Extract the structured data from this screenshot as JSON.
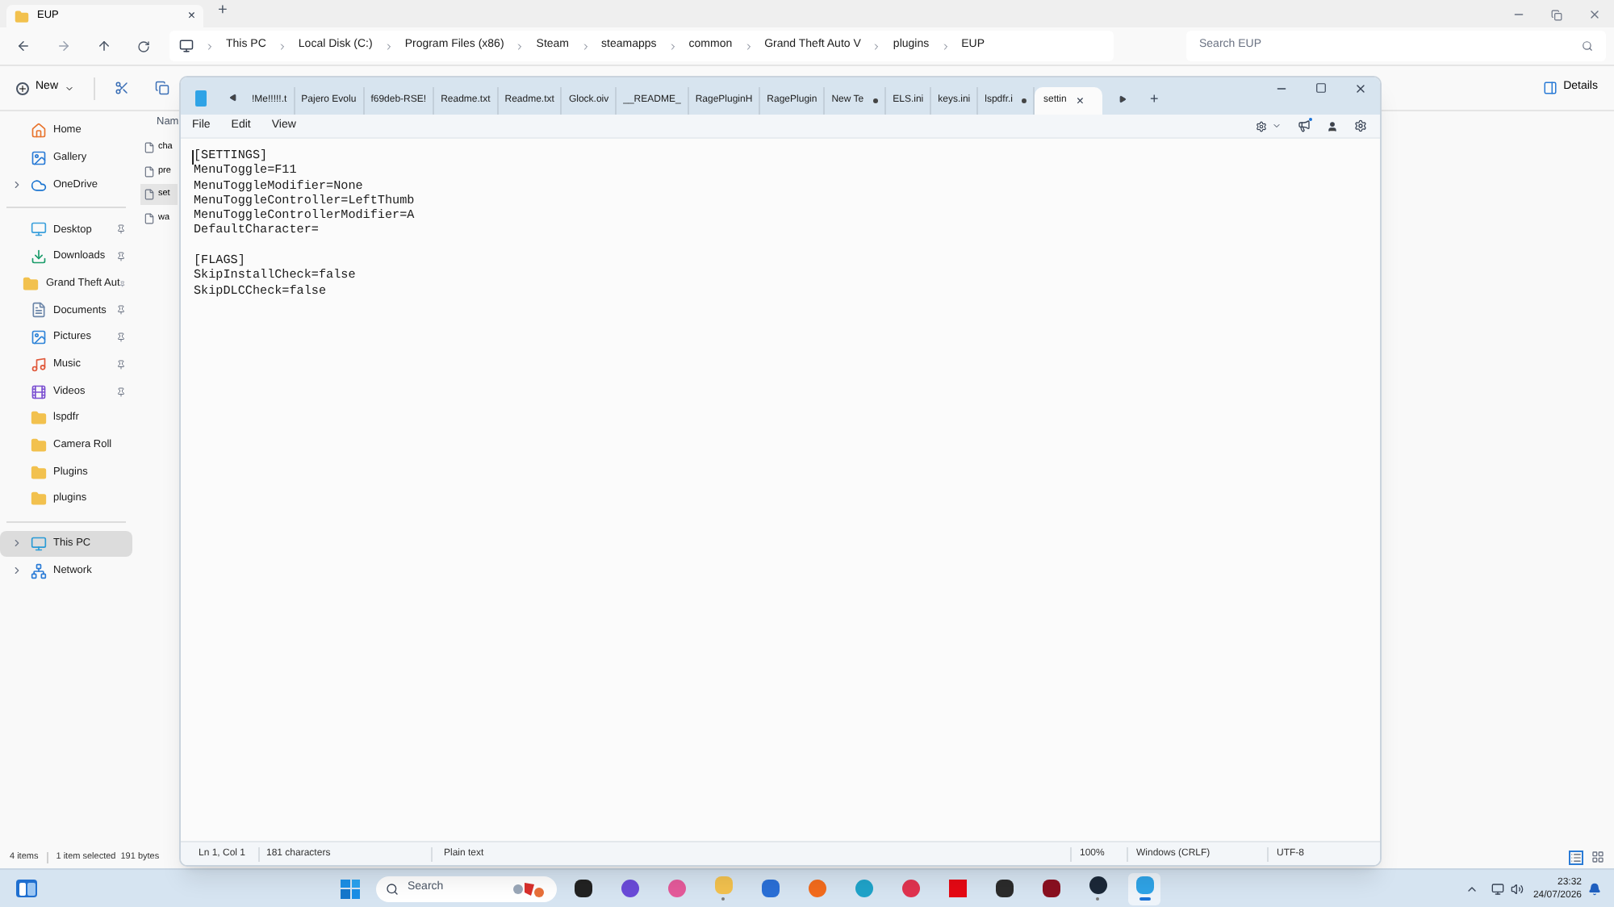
{
  "explorer": {
    "tab": {
      "title": "EUP",
      "close": "×"
    },
    "new_tab": "+",
    "breadcrumb": [
      "This PC",
      "Local Disk (C:)",
      "Program Files (x86)",
      "Steam",
      "steamapps",
      "common",
      "Grand Theft Auto V",
      "plugins",
      "EUP"
    ],
    "search": {
      "placeholder": "Search EUP"
    },
    "toolbar": {
      "new": "New",
      "details": "Details"
    },
    "nav": [
      {
        "label": "Home",
        "selected": false,
        "pinned": false
      },
      {
        "label": "Gallery",
        "selected": false,
        "pinned": false
      },
      {
        "label": "OneDrive",
        "selected": false,
        "pinned": false,
        "expanded": false
      },
      {
        "label": "Desktop",
        "selected": false,
        "pinned": true
      },
      {
        "label": "Downloads",
        "selected": false,
        "pinned": true
      },
      {
        "label": "Grand Theft Aut",
        "selected": false,
        "pinned": true
      },
      {
        "label": "Documents",
        "selected": false,
        "pinned": true
      },
      {
        "label": "Pictures",
        "selected": false,
        "pinned": true
      },
      {
        "label": "Music",
        "selected": false,
        "pinned": true
      },
      {
        "label": "Videos",
        "selected": false,
        "pinned": true
      },
      {
        "label": "lspdfr",
        "selected": false,
        "pinned": false
      },
      {
        "label": "Camera Roll",
        "selected": false,
        "pinned": false
      },
      {
        "label": "Plugins",
        "selected": false,
        "pinned": false
      },
      {
        "label": "plugins",
        "selected": false,
        "pinned": false
      },
      {
        "label": "This PC",
        "selected": true,
        "pinned": false,
        "expanded": false
      },
      {
        "label": "Network",
        "selected": false,
        "pinned": false,
        "expanded": false
      }
    ],
    "file_list": {
      "column_1": "Nam",
      "files": [
        {
          "name": "cha",
          "selected": false
        },
        {
          "name": "pre",
          "selected": false
        },
        {
          "name": "set",
          "selected": true
        },
        {
          "name": "wa",
          "selected": false
        }
      ]
    },
    "status_bar": {
      "count": "4 items",
      "selection": "1 item selected",
      "size": "191 bytes"
    }
  },
  "notepad": {
    "tabs": [
      {
        "label": "!Me!!!!!.t",
        "selected": false,
        "modified": false
      },
      {
        "label": "Pajero Evolu",
        "selected": false,
        "modified": false
      },
      {
        "label": "f69deb-RSE!",
        "selected": false,
        "modified": false
      },
      {
        "label": "Readme.txt",
        "selected": false,
        "modified": false
      },
      {
        "label": "Readme.txt",
        "selected": false,
        "modified": false
      },
      {
        "label": "Glock.oiv",
        "selected": false,
        "modified": false
      },
      {
        "label": "__README_",
        "selected": false,
        "modified": false
      },
      {
        "label": "RagePluginH",
        "selected": false,
        "modified": false
      },
      {
        "label": "RagePlugin",
        "selected": false,
        "modified": false
      },
      {
        "label": "New Te",
        "selected": false,
        "modified": true
      },
      {
        "label": "ELS.ini",
        "selected": false,
        "modified": false
      },
      {
        "label": "keys.ini",
        "selected": false,
        "modified": false
      },
      {
        "label": "lspdfr.i",
        "selected": false,
        "modified": true
      },
      {
        "label": "settin",
        "selected": true,
        "modified": false
      }
    ],
    "tab_close": "×",
    "new_tab": "+",
    "menu": [
      "File",
      "Edit",
      "View"
    ],
    "content": "[SETTINGS]\nMenuToggle=F11\nMenuToggleModifier=None\nMenuToggleController=LeftThumb\nMenuToggleControllerModifier=A\nDefaultCharacter=\n\n[FLAGS]\nSkipInstallCheck=false\nSkipDLCCheck=false",
    "status_bar": {
      "position": "Ln 1, Col 1",
      "characters": "181 characters",
      "format": "Plain text",
      "zoom": "100%",
      "line_endings": "Windows (CRLF)",
      "encoding": "UTF-8"
    }
  },
  "taskbar": {
    "search": {
      "placeholder": "Search"
    },
    "time": "23:32",
    "date": "24/07/2026",
    "apps": [
      {
        "running": false,
        "selected": false
      },
      {
        "running": false,
        "selected": false
      },
      {
        "running": false,
        "selected": false
      },
      {
        "running": true,
        "selected": false
      },
      {
        "running": false,
        "selected": false
      },
      {
        "running": false,
        "selected": false
      },
      {
        "running": false,
        "selected": false
      },
      {
        "running": false,
        "selected": false
      },
      {
        "running": false,
        "selected": false
      },
      {
        "running": false,
        "selected": false
      },
      {
        "running": false,
        "selected": false
      },
      {
        "running": true,
        "selected": false
      },
      {
        "running": true,
        "selected": true
      }
    ]
  }
}
